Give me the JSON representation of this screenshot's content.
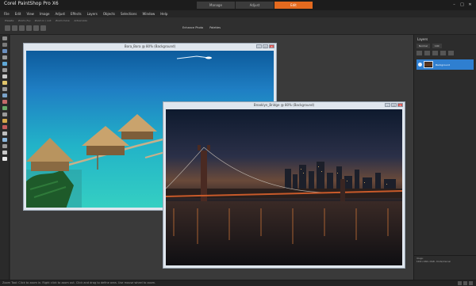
{
  "app": {
    "title": "Corel PaintShop Pro X6"
  },
  "modes": [
    {
      "label": "Manage"
    },
    {
      "label": "Adjust"
    },
    {
      "label": "Edit"
    }
  ],
  "menu": [
    "File",
    "Edit",
    "View",
    "Image",
    "Adjust",
    "Effects",
    "Layers",
    "Objects",
    "Selections",
    "Window",
    "Help"
  ],
  "toolbar": {
    "labels": [
      "Presets:",
      "Zoom (%):",
      "Zoom in / out:",
      "Zoom more:",
      "Actual size:"
    ],
    "enhance_label": "Enhance Photo",
    "palettes_label": "Palettes"
  },
  "windows": {
    "bora": {
      "title": "Bora_Bora @  80% (Background)"
    },
    "brooklyn": {
      "title": "Brooklyn_Bridge @  80% (Background)"
    }
  },
  "layers": {
    "title": "Layers",
    "blend_mode": "Normal",
    "opacity": "100",
    "layer_name": "Background"
  },
  "info": {
    "line1": "Image:",
    "line2": "1000 x 666 x RGB - 8 bits/channel"
  },
  "status": {
    "text": "Zoom Tool: Click to zoom in. Right click to zoom out. Click and drag to define area. Use mouse wheel to zoom."
  },
  "colors": {
    "accent": "#e46a1f",
    "selection": "#2f7fd0"
  }
}
